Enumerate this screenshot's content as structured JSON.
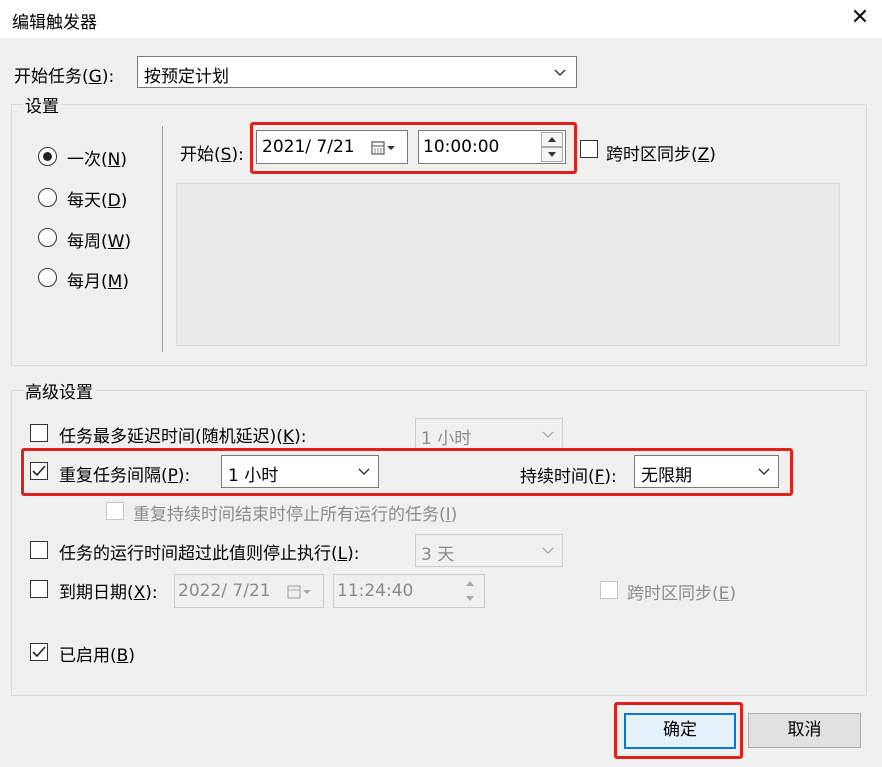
{
  "window": {
    "title": "编辑触发器",
    "close_glyph": "✕"
  },
  "begin_task": {
    "label": "开始任务(",
    "hotkey": "G",
    "label_end": "):",
    "value": "按预定计划"
  },
  "settings": {
    "legend": "设置",
    "radios": [
      {
        "label": "一次(",
        "hotkey": "N",
        "end": ")",
        "checked": true
      },
      {
        "label": "每天(",
        "hotkey": "D",
        "end": ")",
        "checked": false
      },
      {
        "label": "每周(",
        "hotkey": "W",
        "end": ")",
        "checked": false
      },
      {
        "label": "每月(",
        "hotkey": "M",
        "end": ")",
        "checked": false
      }
    ],
    "start_label": "开始(",
    "start_hotkey": "S",
    "start_end": "):",
    "start_date": "2021/  7/21",
    "start_time": "10:00:00",
    "sync_label": "跨时区同步(",
    "sync_hotkey": "Z",
    "sync_end": ")"
  },
  "advanced": {
    "legend": "高级设置",
    "delay": {
      "label": "任务最多延迟时间(随机延迟)(",
      "hotkey": "K",
      "end": "):",
      "value": "1 小时",
      "checked": false
    },
    "repeat": {
      "label": "重复任务间隔(",
      "hotkey": "P",
      "end": "):",
      "value": "1 小时",
      "checked": true
    },
    "duration": {
      "label": "持续时间(",
      "hotkey": "F",
      "end": "):",
      "value": "无限期"
    },
    "stop_all": {
      "label": "重复持续时间结束时停止所有运行的任务(",
      "hotkey": "I",
      "end": ")"
    },
    "stop_if": {
      "label": "任务的运行时间超过此值则停止执行(",
      "hotkey": "L",
      "end": "):",
      "value": "3 天",
      "checked": false
    },
    "expire": {
      "label": "到期日期(",
      "hotkey": "X",
      "end": "):",
      "date": "2022/  7/21",
      "time": "11:24:40",
      "checked": false
    },
    "expire_sync": {
      "label": "跨时区同步(",
      "hotkey": "E",
      "end": ")"
    },
    "enabled": {
      "label": "已启用(",
      "hotkey": "B",
      "end": ")",
      "checked": true
    }
  },
  "buttons": {
    "ok": "确定",
    "cancel": "取消"
  },
  "colors": {
    "highlight": "#e0201a",
    "default_button": "#0078d7"
  }
}
